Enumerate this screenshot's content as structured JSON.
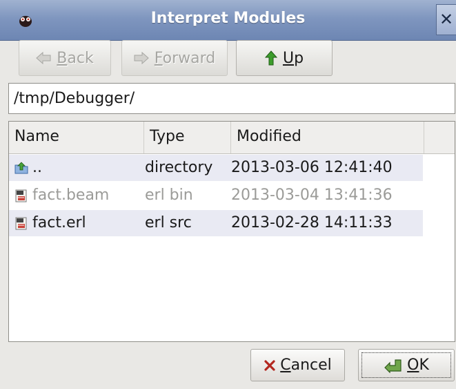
{
  "window": {
    "title": "Interpret Modules",
    "close_label": "✕"
  },
  "toolbar": {
    "back": {
      "before": "",
      "mnemonic": "B",
      "after": "ack",
      "enabled": false
    },
    "forward": {
      "before": "",
      "mnemonic": "F",
      "after": "orward",
      "enabled": false
    },
    "up": {
      "before": "",
      "mnemonic": "U",
      "after": "p",
      "enabled": true
    }
  },
  "path": {
    "value": "/tmp/Debugger/"
  },
  "list": {
    "columns": [
      "Name",
      "Type",
      "Modified"
    ],
    "rows": [
      {
        "name": "..",
        "type": "directory",
        "modified": "2013-03-06 12:41:40",
        "icon": "folder-up-icon"
      },
      {
        "name": "fact.beam",
        "type": "erl bin",
        "modified": "2013-03-04 13:41:36",
        "icon": "erl-file-icon"
      },
      {
        "name": "fact.erl",
        "type": "erl src",
        "modified": "2013-02-28 14:11:33",
        "icon": "erl-file-icon"
      }
    ]
  },
  "buttons": {
    "cancel": {
      "mnemonic": "C",
      "after": "ancel"
    },
    "ok": {
      "mnemonic": "O",
      "after": "K"
    }
  },
  "colors": {
    "titlebar": "#7f96bf",
    "row_highlight": "#e9eaf3",
    "disabled_text": "#9b9b98"
  }
}
